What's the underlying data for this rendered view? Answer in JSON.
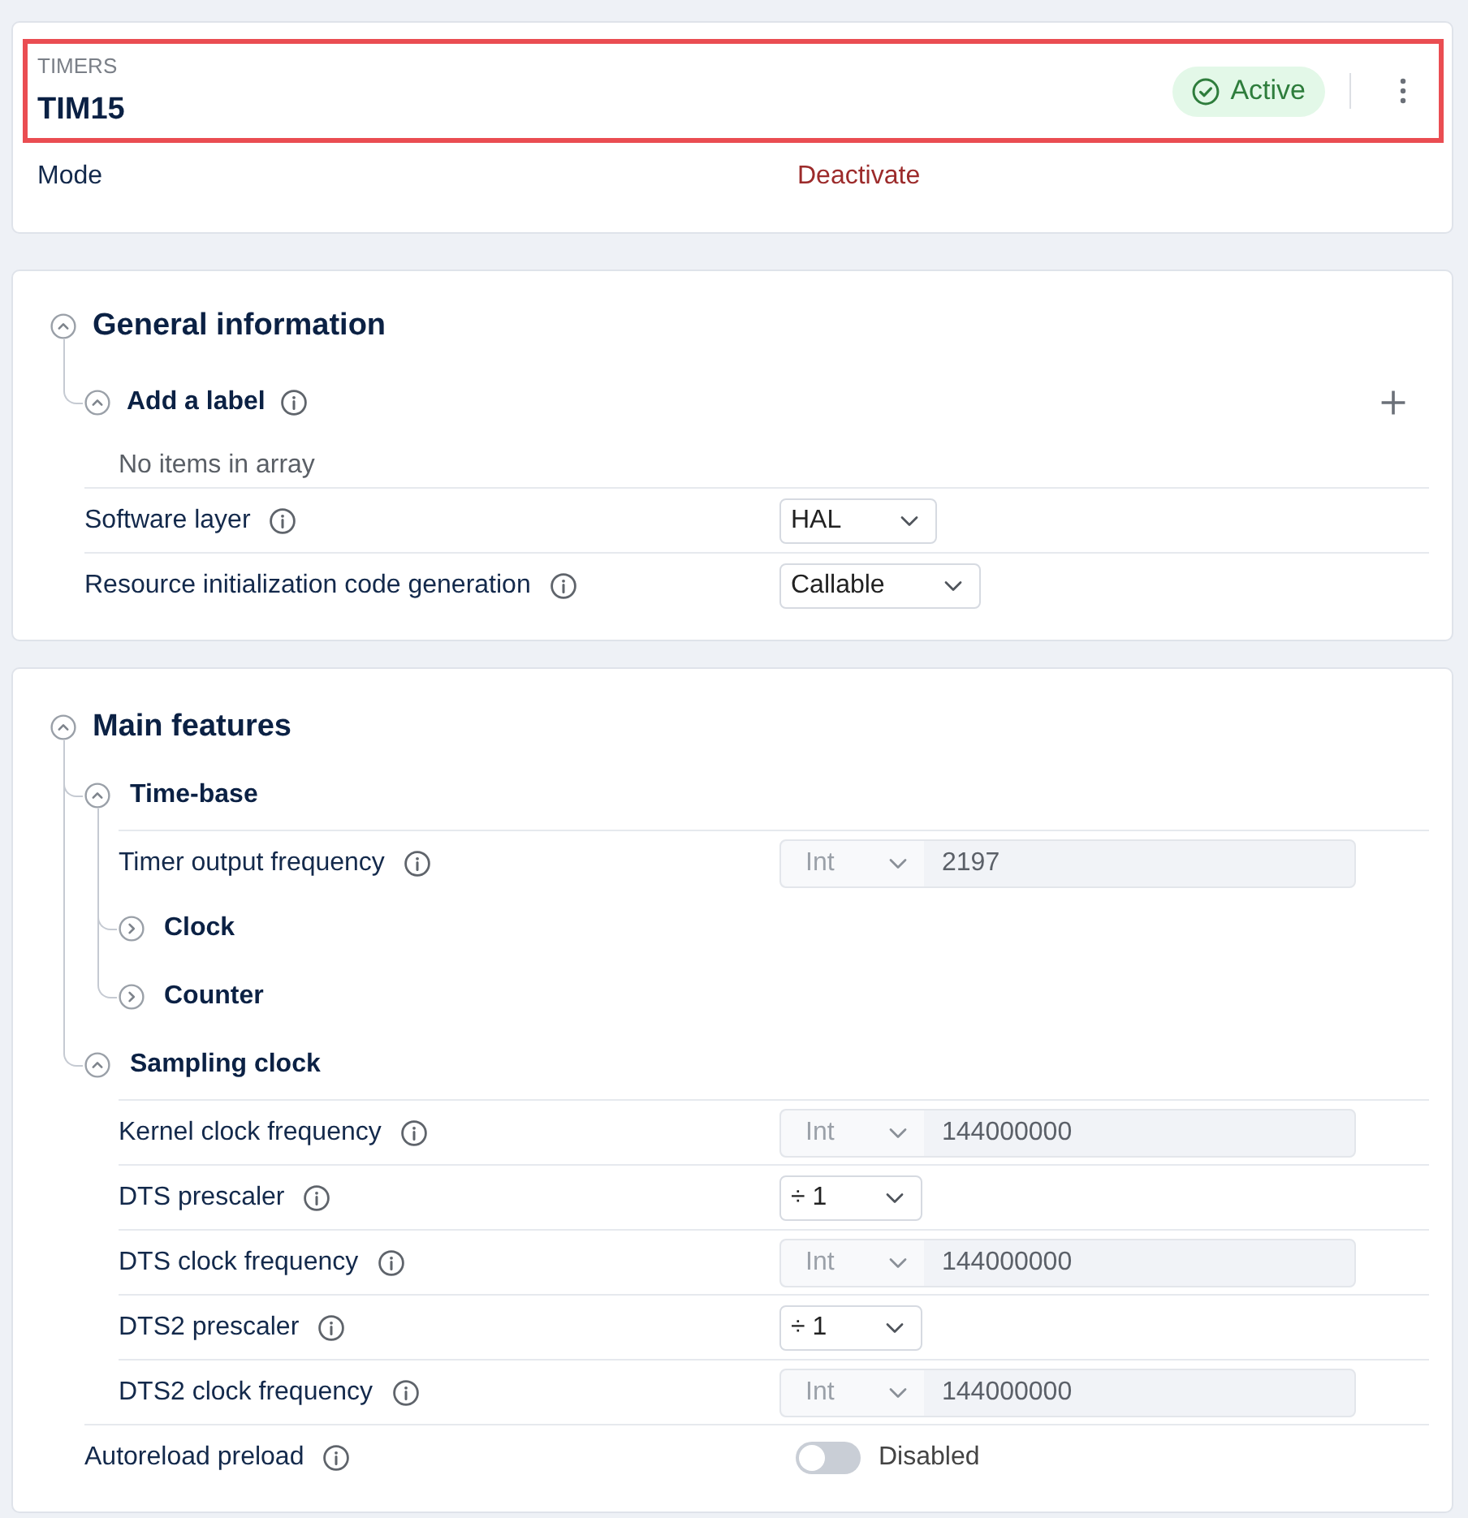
{
  "header": {
    "highlighted": true,
    "category": "TIMERS",
    "title": "TIM15",
    "status": {
      "label": "Active",
      "kind": "active"
    },
    "mode_label": "Mode",
    "mode_action": "Deactivate"
  },
  "sections": [
    {
      "title": "General information",
      "expanded": true,
      "items": [
        {
          "kind": "array",
          "title": "Add a label",
          "expanded": true,
          "empty_text": "No items in array"
        },
        {
          "kind": "select",
          "label": "Software layer",
          "value": "HAL",
          "disabled": false
        },
        {
          "kind": "select",
          "label": "Resource initialization code generation",
          "value": "Callable",
          "disabled": false
        }
      ]
    },
    {
      "title": "Main features",
      "expanded": true,
      "items": [
        {
          "kind": "group",
          "title": "Time-base",
          "expanded": true,
          "children": [
            {
              "kind": "number",
              "label": "Timer output frequency",
              "type": "Int",
              "value": "2197",
              "disabled": true
            },
            {
              "kind": "group",
              "title": "Clock",
              "expanded": false
            },
            {
              "kind": "group",
              "title": "Counter",
              "expanded": false
            }
          ]
        },
        {
          "kind": "group",
          "title": "Sampling clock",
          "expanded": true,
          "children": [
            {
              "kind": "number",
              "label": "Kernel clock frequency",
              "type": "Int",
              "value": "144000000",
              "disabled": true
            },
            {
              "kind": "select",
              "label": "DTS prescaler",
              "value": "÷ 1",
              "disabled": false
            },
            {
              "kind": "number",
              "label": "DTS clock frequency",
              "type": "Int",
              "value": "144000000",
              "disabled": true
            },
            {
              "kind": "select",
              "label": "DTS2 prescaler",
              "value": "÷ 1",
              "disabled": false
            },
            {
              "kind": "number",
              "label": "DTS2 clock frequency",
              "type": "Int",
              "value": "144000000",
              "disabled": true
            }
          ]
        },
        {
          "kind": "toggle",
          "label": "Autoreload preload",
          "on": false,
          "value": "Disabled"
        }
      ]
    }
  ]
}
